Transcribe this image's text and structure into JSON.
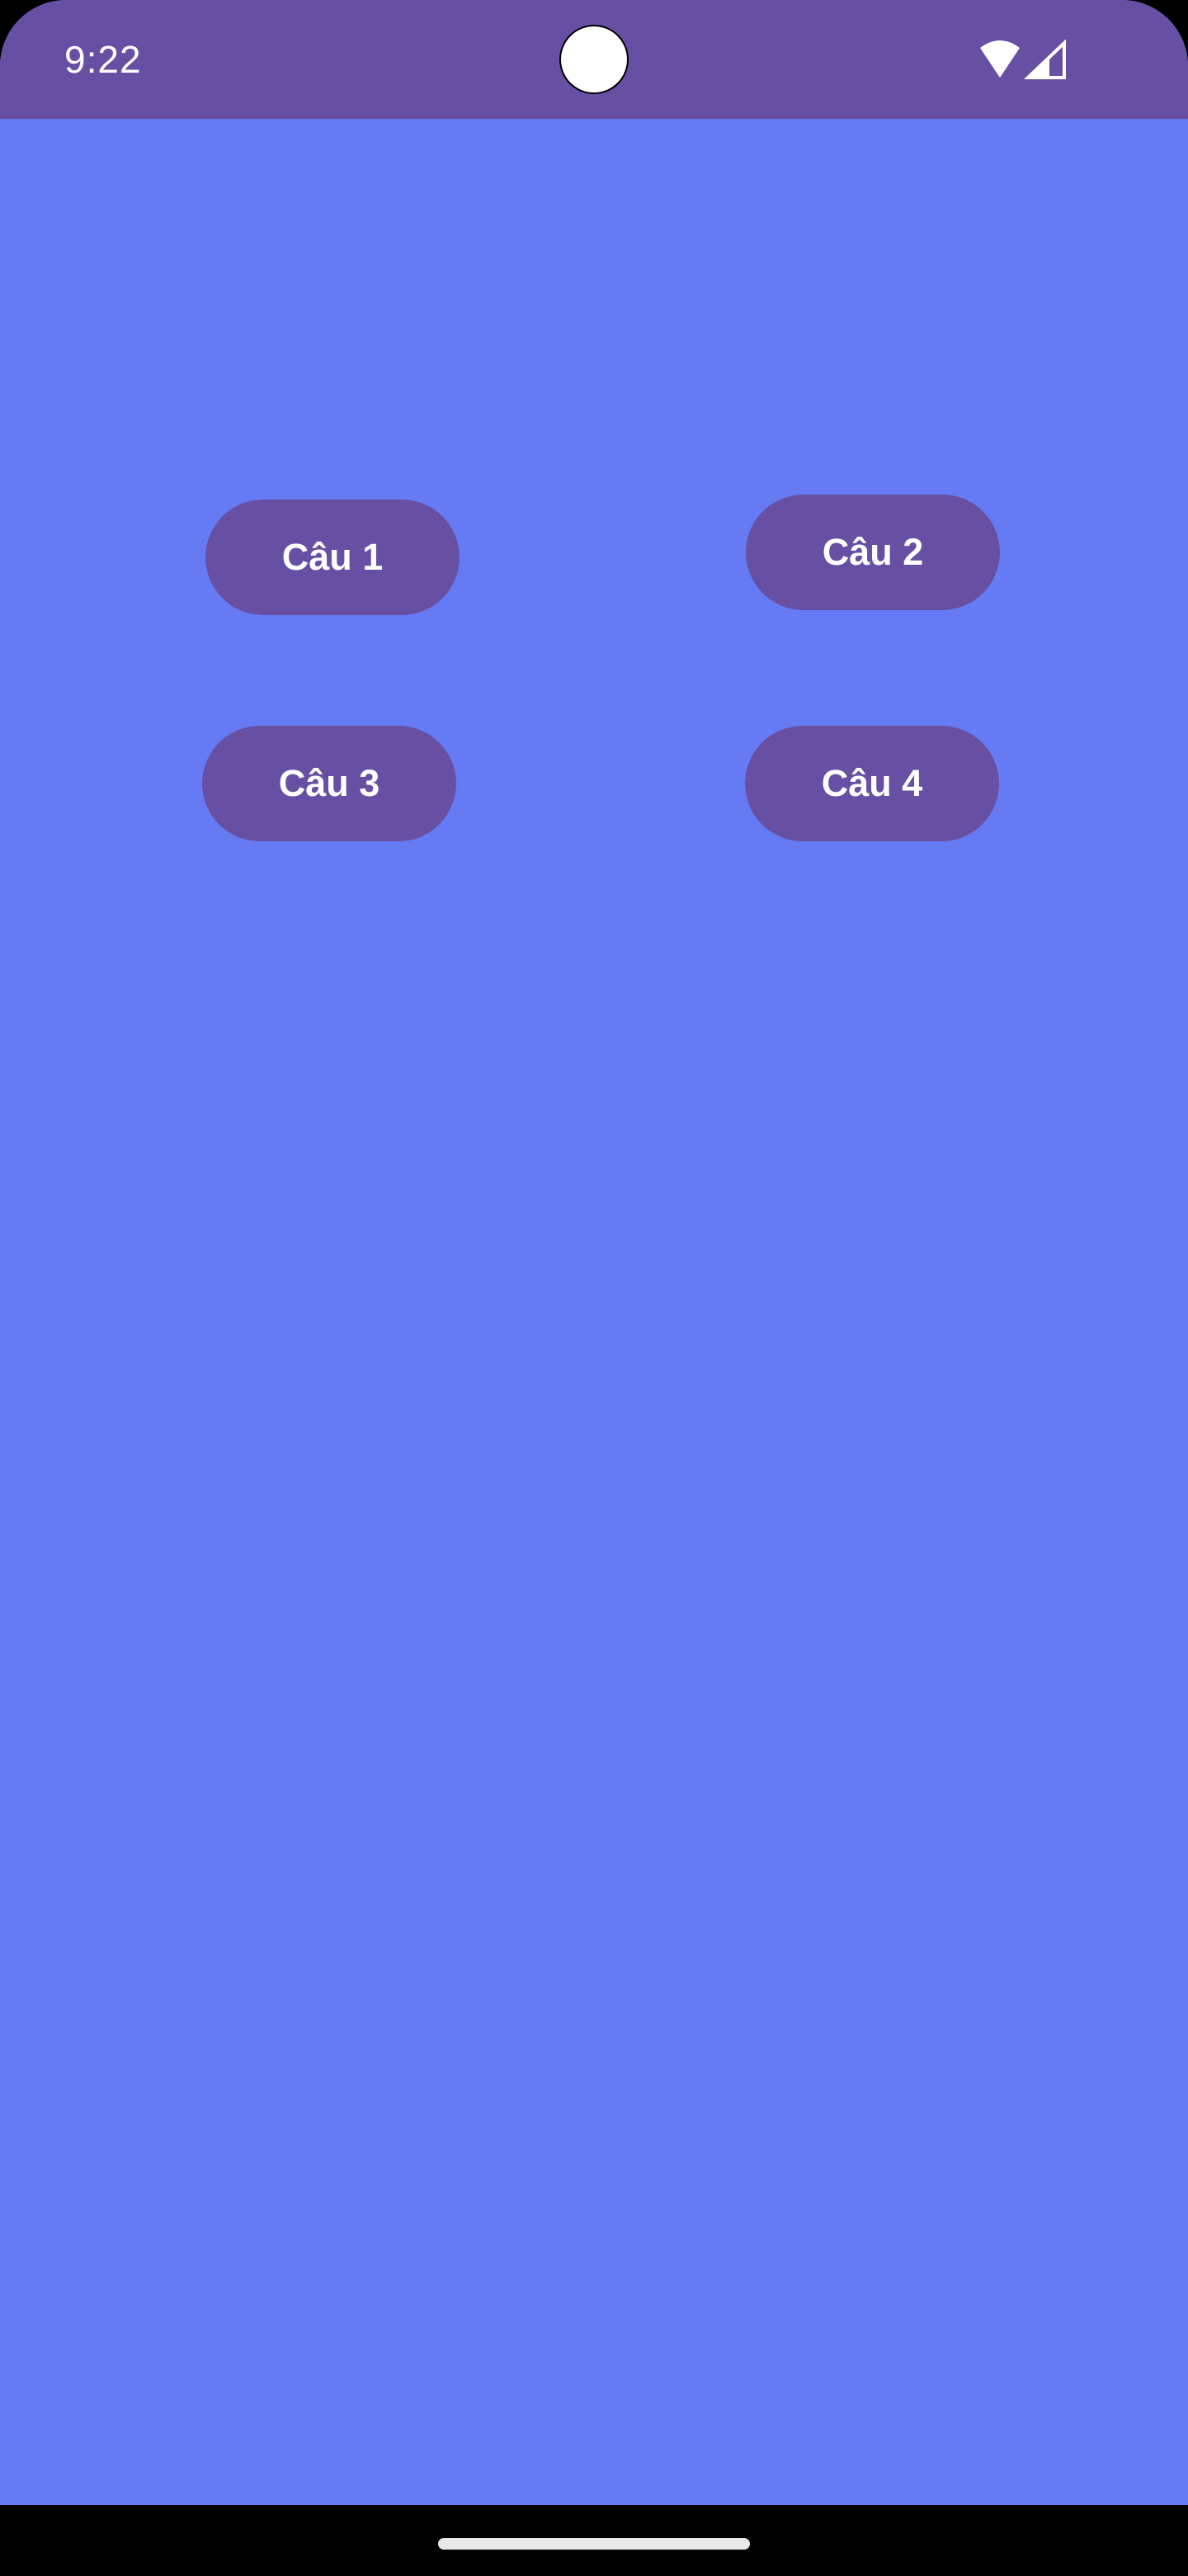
{
  "status_bar": {
    "time": "9:22",
    "icons": [
      "wifi-icon",
      "cellular-signal-icon"
    ],
    "background_color": "#6750a4"
  },
  "screen": {
    "background_color": "#667bf3"
  },
  "buttons": [
    {
      "label": "Câu 1"
    },
    {
      "label": "Câu 2"
    },
    {
      "label": "Câu 3"
    },
    {
      "label": "Câu 4"
    }
  ],
  "colors": {
    "button_background": "#6750a4",
    "button_text": "#ffffff"
  },
  "navigation_bar": {
    "type": "gesture-handle"
  }
}
